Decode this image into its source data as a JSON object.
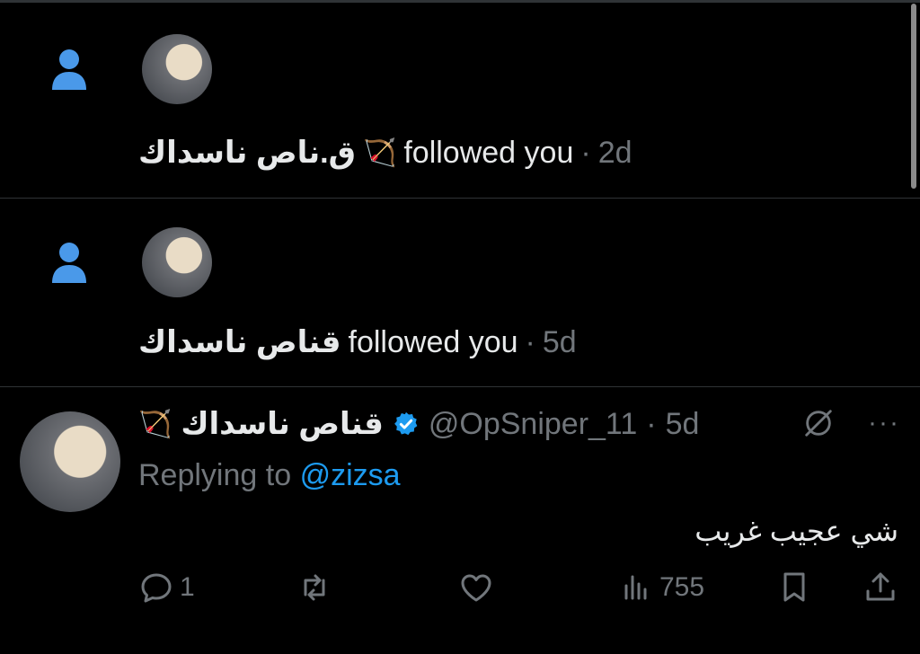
{
  "notifications": [
    {
      "name": "ق.ناص ناسداك",
      "name_emoji": "🏹",
      "action": "followed you",
      "separator": "·",
      "time": "2d"
    },
    {
      "name": "قناص ناسداك",
      "action": "followed you",
      "separator": "·",
      "time": "5d"
    }
  ],
  "tweet": {
    "display_name": "قناص ناسداك",
    "name_emoji": "🏹",
    "verified": true,
    "handle": "@OpSniper_11",
    "separator": "·",
    "time": "5d",
    "replying_to_label": "Replying to",
    "replying_to_handle": "@zizsa",
    "text": "شي عجيب غريب",
    "more_label": "···",
    "actions": {
      "reply_count": "1",
      "retweet_count": "",
      "like_count": "",
      "views_count": "755"
    }
  },
  "icons": {
    "notification_type": "person-icon",
    "reply": "comment-icon",
    "retweet": "retweet-icon",
    "like": "heart-icon",
    "views": "analytics-icon",
    "bookmark": "bookmark-icon",
    "share": "share-icon",
    "grok": "grok-slash-circle-icon",
    "verified": "verified-badge-icon"
  },
  "colors": {
    "background": "#000000",
    "primary_text": "#e7e9ea",
    "muted_text": "#71767b",
    "accent_blue": "#1d9bf0",
    "icon_blue": "#4a99e9",
    "divider": "#2f3336"
  }
}
